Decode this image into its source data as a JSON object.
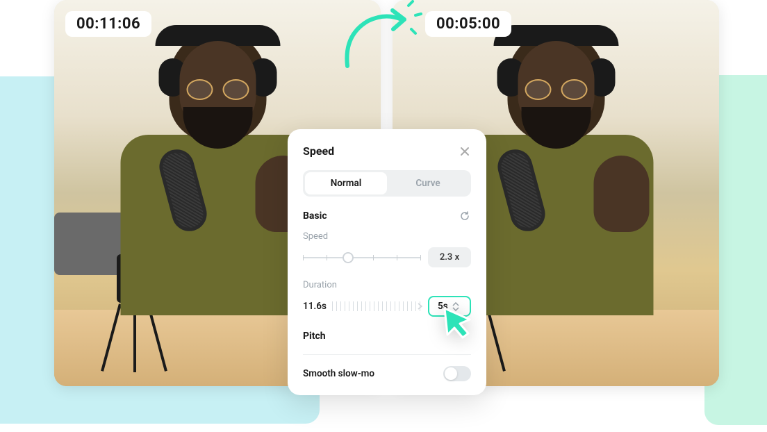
{
  "timestamps": {
    "before": "00:11:06",
    "after": "00:05:00"
  },
  "panel": {
    "title": "Speed",
    "tabs": {
      "normal": "Normal",
      "curve": "Curve"
    },
    "basic_label": "Basic",
    "speed_label": "Speed",
    "speed_value": "2.3 x",
    "duration_label": "Duration",
    "duration_from": "11.6s",
    "duration_to": "5s",
    "pitch_label": "Pitch",
    "slowmo_label": "Smooth slow-mo"
  },
  "colors": {
    "accent": "#2de3b8"
  }
}
